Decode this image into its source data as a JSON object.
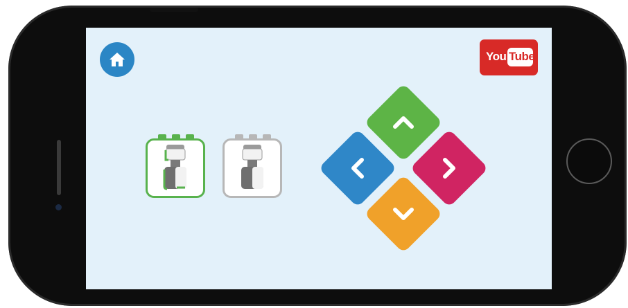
{
  "app": {
    "home_icon": "home-icon",
    "youtube": {
      "label_you": "You",
      "label_tube": "Tube",
      "color": "#d82a27"
    },
    "robot_selector": {
      "items": [
        {
          "icon": "robot-cube-icon",
          "state": "selected",
          "accent": "#58b24d"
        },
        {
          "icon": "robot-cube-icon",
          "state": "unselected",
          "accent": "#b7b7b7"
        }
      ]
    },
    "dpad": {
      "up": {
        "icon": "chevron-up-icon",
        "color": "#5db446"
      },
      "left": {
        "icon": "chevron-left-icon",
        "color": "#2f87c8"
      },
      "right": {
        "icon": "chevron-right-icon",
        "color": "#d02462"
      },
      "down": {
        "icon": "chevron-down-icon",
        "color": "#f0a12a"
      }
    },
    "screen_background": "#e3f1fa"
  }
}
